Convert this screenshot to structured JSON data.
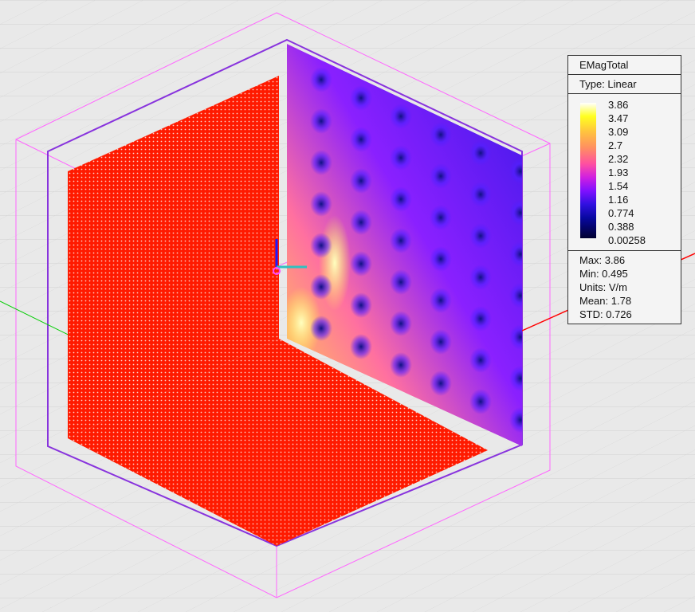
{
  "legend": {
    "title": "EMagTotal",
    "type": "Type: Linear",
    "scale_values": [
      "3.86",
      "3.47",
      "3.09",
      "2.7",
      "2.32",
      "1.93",
      "1.54",
      "1.16",
      "0.774",
      "0.388",
      "0.00258"
    ],
    "stats": {
      "max": "Max: 3.86",
      "min": "Min: 0.495",
      "units": "Units: V/m",
      "mean": "Mean: 1.78",
      "std": "STD: 0.726"
    }
  },
  "colors": {
    "background": "#e9e9e9",
    "region_box": "#ff55ff",
    "boundary_box": "#8833dd",
    "sheet": "#ff1a00",
    "x_axis": "#ff0000",
    "y_axis": "#00cc00",
    "field_low": "#3010e0",
    "field_high": "#ffff20"
  },
  "colormap": "black-blue-purple-pink-orange-yellow-white"
}
